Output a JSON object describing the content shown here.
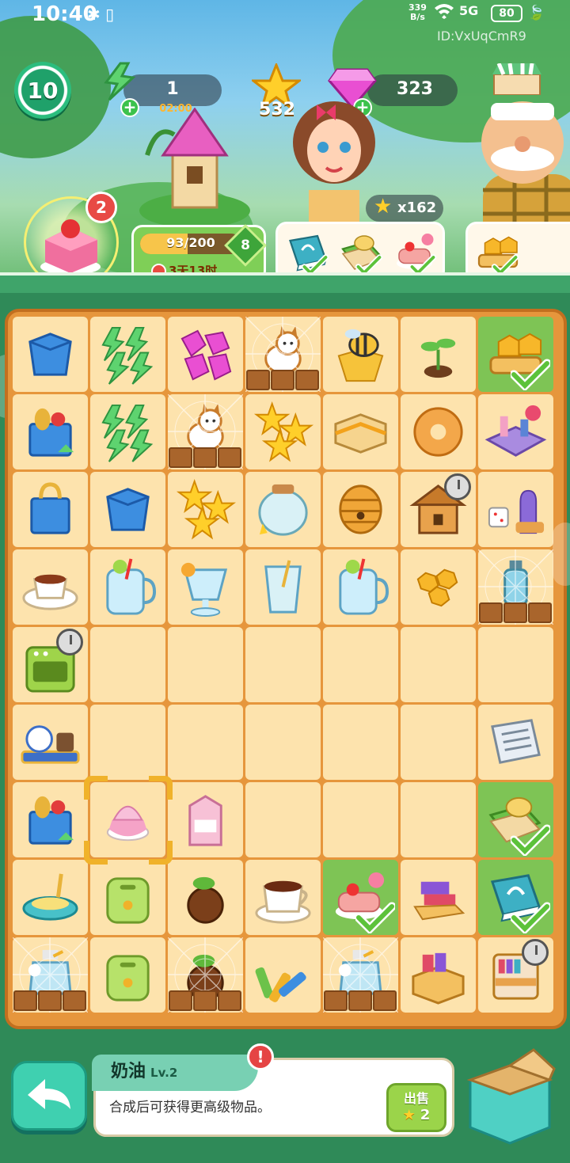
{
  "status_bar": {
    "time": "10:40",
    "icons": "✱ ▯",
    "net_speed_value": "339",
    "net_speed_unit": "B/s",
    "signal": "5G",
    "battery": "80",
    "user_id": "ID:VxUqCmR9"
  },
  "hud": {
    "player_level": "10",
    "energy_value": "1",
    "energy_timer": "02:00",
    "stars_value": "532",
    "gems_value": "323"
  },
  "scene": {
    "order_badge_count": "2",
    "progress_text": "93/200",
    "progress_fraction": 0.465,
    "progress_level": "8",
    "progress_eta": "3天13时",
    "star_multiplier": "x162"
  },
  "tasks": {
    "card1_items": [
      "book-icon",
      "frog-book-icon",
      "pancake-icon"
    ],
    "card2_items": [
      "honey-cake-icon"
    ]
  },
  "board": {
    "rows": [
      [
        "paper-bag-icon",
        "energy-icon",
        "gem-icon",
        "cat-icon",
        "bee-icon",
        "sprout-icon",
        "honey-cake-icon"
      ],
      [
        "grocery-bag-icon",
        "energy-icon",
        "cat-icon",
        "star-icon",
        "sandwich-icon",
        "donut-icon",
        "chessboard-icon"
      ],
      [
        "shopping-bag-icon",
        "paper-bag-icon",
        "star-icon",
        "jar-icon",
        "beehive-icon",
        "beehouse-icon",
        "board-game-icon"
      ],
      [
        "teacup-icon",
        "juice-jar-icon",
        "juice-glass-icon",
        "water-glass-icon",
        "juice-jar-icon",
        "honeycomb-icon",
        "bottle-icon"
      ],
      [
        "oven-icon",
        "",
        "",
        "",
        "",
        "",
        ""
      ],
      [
        "tea-set-icon",
        "",
        "",
        "",
        "",
        "",
        "newspaper-icon"
      ],
      [
        "grocery-bag-icon",
        "cream-icon",
        "milk-icon",
        "",
        "",
        "",
        "frog-book-icon"
      ],
      [
        "bath-toy-icon",
        "toaster-icon",
        "seed-icon",
        "coffee-cup-icon",
        "pancake-icon",
        "books-icon",
        "book-icon"
      ],
      [
        "perfume-icon",
        "toaster-icon",
        "seed-icon",
        "crayons-icon",
        "perfume-icon",
        "book-drawer-icon",
        "book-cart-icon"
      ]
    ],
    "done_cells": [
      "0-6",
      "6-6",
      "7-4",
      "7-6"
    ],
    "locked_cells": [
      "0-3",
      "1-2",
      "3-6",
      "8-0",
      "8-2",
      "8-4"
    ],
    "timer_cells": [
      "2-5",
      "4-0",
      "8-6"
    ],
    "selected_cell": "6-1"
  },
  "bottom": {
    "item_name": "奶油",
    "item_level": "Lv.2",
    "description": "合成后可获得更高级物品。",
    "alert_mark": "!",
    "sell_label": "出售",
    "sell_price": "2"
  },
  "colors": {
    "accent_green": "#7ec455",
    "board_orange": "#e6963c",
    "cell_tan": "#fde3ad",
    "gem_pink": "#e94fd2",
    "energy_green": "#5ed36f",
    "star_gold": "#ffcf2a"
  }
}
